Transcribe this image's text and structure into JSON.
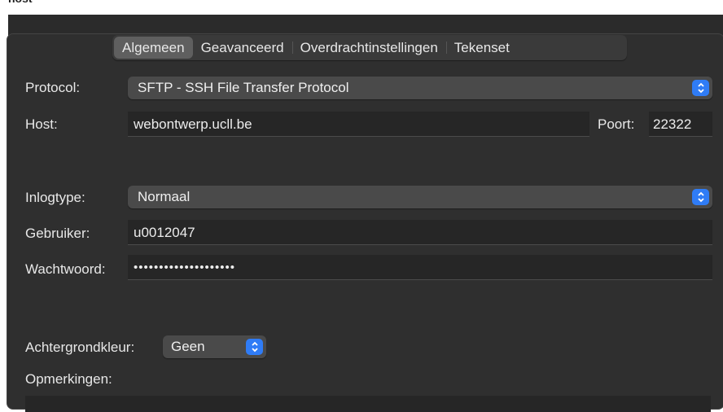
{
  "window": {
    "title_fragment": "nost"
  },
  "tabs": [
    {
      "label": "Algemeen",
      "active": true
    },
    {
      "label": "Geavanceerd",
      "active": false
    },
    {
      "label": "Overdrachtinstellingen",
      "active": false
    },
    {
      "label": "Tekenset",
      "active": false
    }
  ],
  "form": {
    "protocol_label": "Protocol:",
    "protocol_value": "SFTP - SSH File Transfer Protocol",
    "host_label": "Host:",
    "host_value": "webontwerp.ucll.be",
    "port_label": "Poort:",
    "port_value": "22322",
    "logintype_label": "Inlogtype:",
    "logintype_value": "Normaal",
    "user_label": "Gebruiker:",
    "user_value": "u0012047",
    "password_label": "Wachtwoord:",
    "password_value": "••••••••••••••••••••",
    "bgcolor_label": "Achtergrondkleur:",
    "bgcolor_value": "Geen",
    "notes_label": "Opmerkingen:"
  },
  "icons": {
    "stepper": "chevron-up-down-icon"
  },
  "colors": {
    "accent": "#2f7cf6",
    "background": "#2b2b2b"
  }
}
